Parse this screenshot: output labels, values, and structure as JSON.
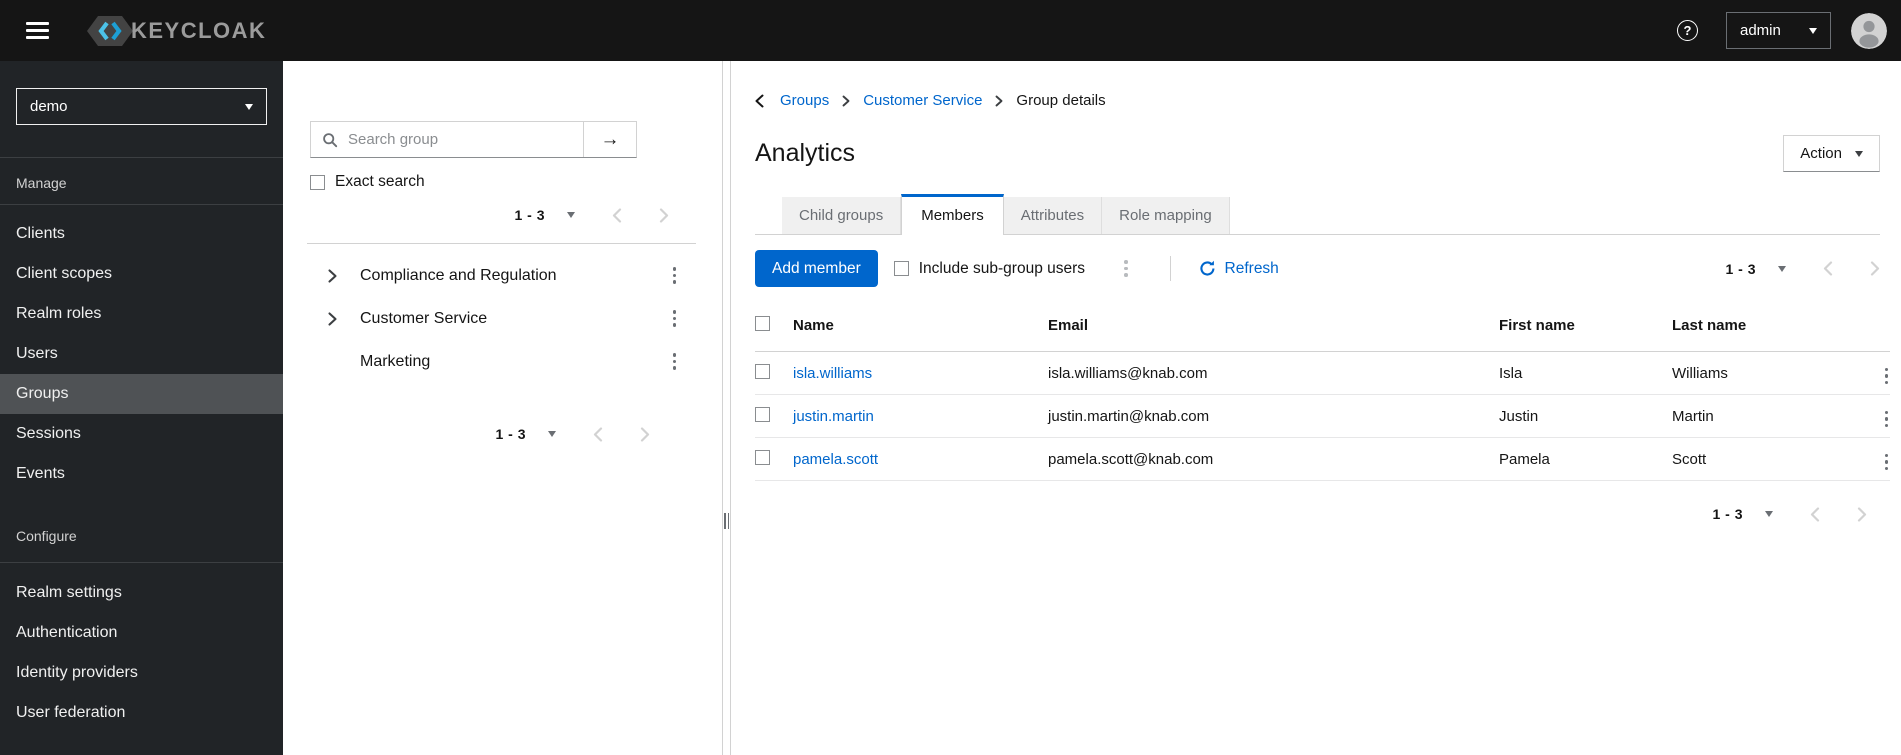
{
  "masthead": {
    "brand": "KEYCLOAK",
    "user": "admin"
  },
  "icons": {
    "hamburger_icon": "bars",
    "help": "?",
    "arrow_right": "→",
    "search_icon": "magnifier",
    "kebab_icon": "three-dots-vertical",
    "caret_down_icon": "triangle-down",
    "chevron_left_icon": "angle-left",
    "chevron_right_icon": "angle-right",
    "refresh_icon": "sync-circular-arrow",
    "avatar_icon": "person-silhouette",
    "splitter_icon": "drag-handle"
  },
  "colors": {
    "accent": "#0066cc",
    "masthead_bg": "#151515",
    "sidebar_bg": "#212427",
    "sidebar_selected_bg": "#4f5255",
    "link": "#0066cc",
    "border": "#d2d2d2",
    "muted_text": "#6a6e73"
  },
  "sidebar": {
    "realm": "demo",
    "sections": [
      {
        "label": "Manage",
        "items": [
          "Clients",
          "Client scopes",
          "Realm roles",
          "Users",
          "Groups",
          "Sessions",
          "Events"
        ],
        "selected_item": "Groups"
      },
      {
        "label": "Configure",
        "items": [
          "Realm settings",
          "Authentication",
          "Identity providers",
          "User federation"
        ]
      }
    ]
  },
  "tree": {
    "search_placeholder": "Search group",
    "exact_search_label": "Exact search",
    "pagination_top": "1 - 3",
    "pagination_bottom": "1 - 3",
    "groups": [
      {
        "name": "Compliance and Regulation",
        "expandable": true
      },
      {
        "name": "Customer Service",
        "expandable": true
      },
      {
        "name": "Marketing",
        "expandable": false
      }
    ]
  },
  "main": {
    "breadcrumb": [
      "Groups",
      "Customer Service",
      "Group details"
    ],
    "title": "Analytics",
    "action_button": "Action",
    "tabs": [
      {
        "label": "Child groups",
        "active": false
      },
      {
        "label": "Members",
        "active": true
      },
      {
        "label": "Attributes",
        "active": false
      },
      {
        "label": "Role mapping",
        "active": false
      }
    ],
    "toolbar": {
      "add_member": "Add member",
      "include_subgroups": "Include sub-group users",
      "refresh": "Refresh",
      "pagination": "1 - 3"
    },
    "table": {
      "headers": [
        "Name",
        "Email",
        "First name",
        "Last name"
      ],
      "rows": [
        {
          "username": "isla.williams",
          "email": "isla.williams@knab.com",
          "first_name": "Isla",
          "last_name": "Williams"
        },
        {
          "username": "justin.martin",
          "email": "justin.martin@knab.com",
          "first_name": "Justin",
          "last_name": "Martin"
        },
        {
          "username": "pamela.scott",
          "email": "pamela.scott@knab.com",
          "first_name": "Pamela",
          "last_name": "Scott"
        }
      ]
    },
    "pagination_bottom": "1 - 3"
  }
}
